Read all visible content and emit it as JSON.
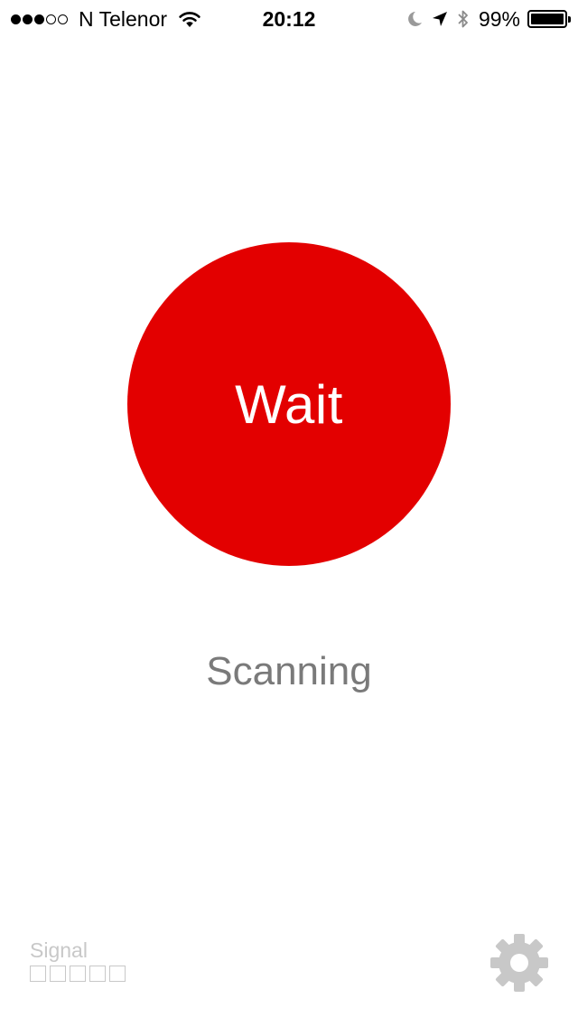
{
  "status_bar": {
    "signal_dots": [
      "filled",
      "filled",
      "filled",
      "empty",
      "empty"
    ],
    "carrier": "N Telenor",
    "time": "20:12",
    "battery_percent": "99%",
    "battery_level": 0.99,
    "icons": [
      "wifi-icon",
      "moon-icon",
      "location-arrow-icon",
      "bluetooth-icon",
      "battery-icon"
    ]
  },
  "main": {
    "button_label": "Wait",
    "status_text": "Scanning"
  },
  "signal": {
    "label": "Signal",
    "bars_total": 5,
    "bars_active": 0
  },
  "settings": {
    "icon": "gear-icon"
  },
  "colors": {
    "accent": "#e30000",
    "status_text": "#7a7a7a",
    "muted": "#c8c8c8",
    "gear": "#c8c8c8"
  }
}
